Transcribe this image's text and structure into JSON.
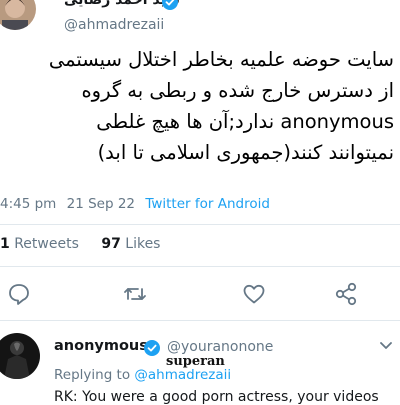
{
  "original_tweet": {
    "display_name": "سید احمد رضایی",
    "handle": "@ahmadrezaii",
    "text_lines": [
      "سایت حوضه علمیه بخاطر اختلال سیستمی",
      "از دسترس خارج شده و ربطی به گروه",
      "anonymous ندارد;آن ها هیچ غلطی",
      "نمیتوانند کنند(جمهوری اسلامی تا ابد)"
    ],
    "time": "4:45 pm",
    "date": "21 Sep 22",
    "source": "Twitter for Android",
    "retweets_count": "1",
    "retweets_label": "Retweets",
    "likes_count": "97",
    "likes_label": "Likes",
    "icons": [
      "comment-icon",
      "retweet-icon",
      "like-icon",
      "share-icon"
    ]
  },
  "reply": {
    "display_name": "anonymous",
    "handle": "@youranonone",
    "replying_to_prefix": "Replying to",
    "replying_to_handle": "@ahmadrezaii",
    "text_partial": "RK: You were a good porn actress, your videos",
    "watermark": "superan"
  },
  "colors": {
    "accent": "#1da1f2",
    "muted": "#657786",
    "divider": "#e1e8ed"
  }
}
